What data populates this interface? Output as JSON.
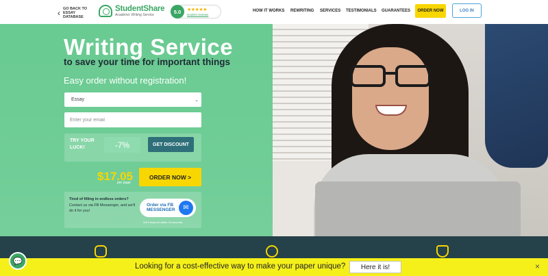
{
  "header": {
    "back_label": "GO BACK TO ESSAY DATABASE",
    "logo_name": "StudentShare",
    "logo_sub": "Academic Writing Service",
    "rating_value": "5.0",
    "rating_stars": "★★★★★",
    "rating_label": "student reviews",
    "nav": [
      "HOW IT WORKS",
      "REWRITING",
      "SERVICES",
      "TESTIMONIALS",
      "GUARANTEES"
    ],
    "order_button": "ORDER NOW",
    "login_button": "LOG IN"
  },
  "hero": {
    "title": "Writing Service",
    "subtitle": "to save your time for important things",
    "tagline": "Easy order without registration!",
    "paper_type_selected": "Essay",
    "email_placeholder": "Enter your email",
    "luck_text": "TRY YOUR LUCK!",
    "discount_value": "-7%",
    "get_discount_button": "GET DISCOUNT",
    "price": "$17.05",
    "per_page": "per page",
    "order_now_button": "ORDER NOW >",
    "fb_tired": "Tired of filling in endless orders?",
    "fb_contact": "Contact us via FB Messenger, and we'll do it for you!",
    "fb_button": "Order via FB MESSENGER",
    "fb_respond": "We'll respond within 10 seconds."
  },
  "banner": {
    "text": "Looking for a cost-effective way to make your paper unique?",
    "button": "Here it is!",
    "close": "×"
  },
  "icons": {
    "back": "chevron-left-icon",
    "chat": "chat-icon",
    "messenger": "messenger-icon",
    "select_chevron": "chevron-down-icon"
  },
  "colors": {
    "brand_green": "#3aa664",
    "hero_green": "#6acb92",
    "accent_yellow": "#f8d600",
    "dark_teal": "#25414a",
    "banner_yellow": "#f5f01a"
  }
}
